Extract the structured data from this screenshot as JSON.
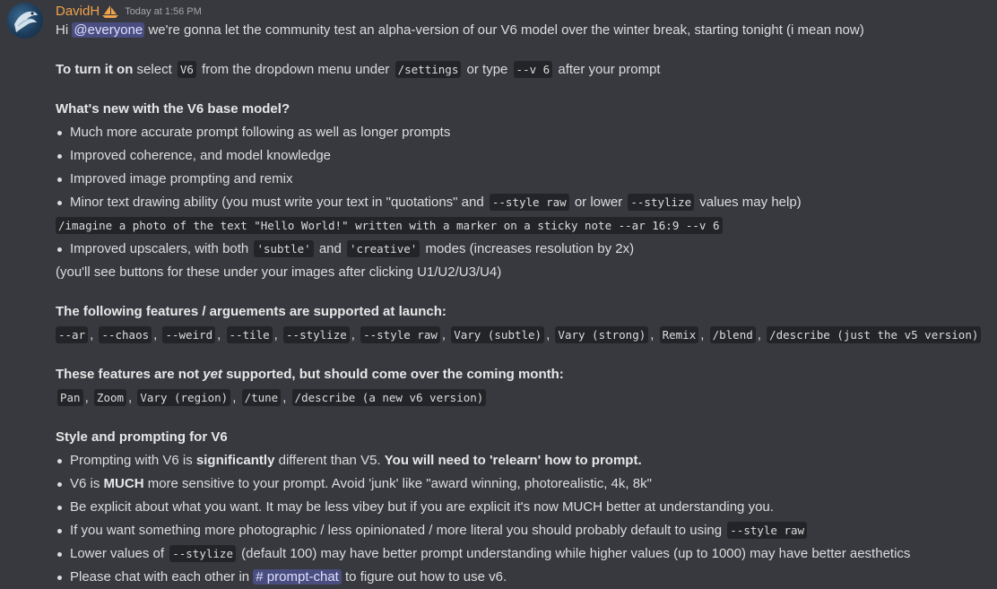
{
  "message": {
    "author": "DavidH",
    "timestamp": "Today at 1:56 PM",
    "intro": {
      "hi": "Hi",
      "mention": "@everyone",
      "text": "we're gonna let the community test an alpha-version of our V6 model over the winter break, starting tonight (i mean now)"
    },
    "turn_on": {
      "bold": "To turn it on",
      "t1": "select",
      "c1": "V6",
      "t2": "from the dropdown menu under",
      "c2": "/settings",
      "t3": "or type",
      "c3": "--v 6",
      "t4": "after your prompt"
    },
    "whats_new": {
      "heading": "What's new with the V6 base model?",
      "b1": "Much more accurate prompt following as well as longer prompts",
      "b2": "Improved coherence, and model knowledge",
      "b3": "Improved image prompting and remix",
      "b4_t1": "Minor text drawing ability (you must write your text in \"quotations\" and",
      "b4_c1": "--style raw",
      "b4_t2": "or lower",
      "b4_c2": "--stylize",
      "b4_t3": "values may help)",
      "example": "/imagine a photo of the text \"Hello World!\" written with a marker on a sticky note --ar 16:9 --v 6",
      "b5_t1": "Improved upscalers, with both",
      "b5_c1": "'subtle'",
      "b5_t2": "and",
      "b5_c2": "'creative'",
      "b5_t3": "modes (increases resolution by 2x)",
      "note": "(you'll see buttons for these under your images after clicking U1/U2/U3/U4)"
    },
    "supported": {
      "heading": "The following features / arguements are supported at launch:",
      "items": [
        "--ar",
        "--chaos",
        "--weird",
        "--tile",
        "--stylize",
        "--style raw",
        "Vary (subtle)",
        "Vary (strong)",
        "Remix",
        "/blend",
        "/describe (just the v5 version)"
      ],
      "seps": [
        ",",
        ",",
        ",",
        ",",
        ",",
        ",",
        ",",
        ",",
        ",",
        ","
      ]
    },
    "not_supported": {
      "h_t1": "These features are not",
      "h_em": "yet",
      "h_t2": "supported, but should come over the coming month:",
      "items": [
        "Pan",
        "Zoom",
        "Vary (region)",
        "/tune",
        "/describe (a new v6 version)"
      ],
      "seps": [
        ",",
        ",",
        ",",
        ","
      ]
    },
    "style": {
      "heading": "Style and prompting for V6",
      "b1_t1": "Prompting with V6 is",
      "b1_b1": "significantly",
      "b1_t2": "different than V5.",
      "b1_b2": "You will need to 'relearn' how to prompt.",
      "b2_t1": "V6 is",
      "b2_b1": "MUCH",
      "b2_t2": "more sensitive to your prompt. Avoid 'junk' like \"award winning, photorealistic, 4k, 8k\"",
      "b3": "Be explicit about what you want. It may be less vibey but if you are explicit it's now MUCH better at understanding you.",
      "b4_t1": "If you want something more photographic / less opinionated / more literal you should probably default to using",
      "b4_c1": "--style raw",
      "b5_t1": "Lower values of",
      "b5_c1": "--stylize",
      "b5_t2": "(default 100) may have better prompt understanding while higher values (up to 1000) may have better aesthetics",
      "b6_t1": "Please chat with each other in",
      "b6_channel": "# prompt-chat",
      "b6_t2": "to figure out how to use v6."
    }
  }
}
